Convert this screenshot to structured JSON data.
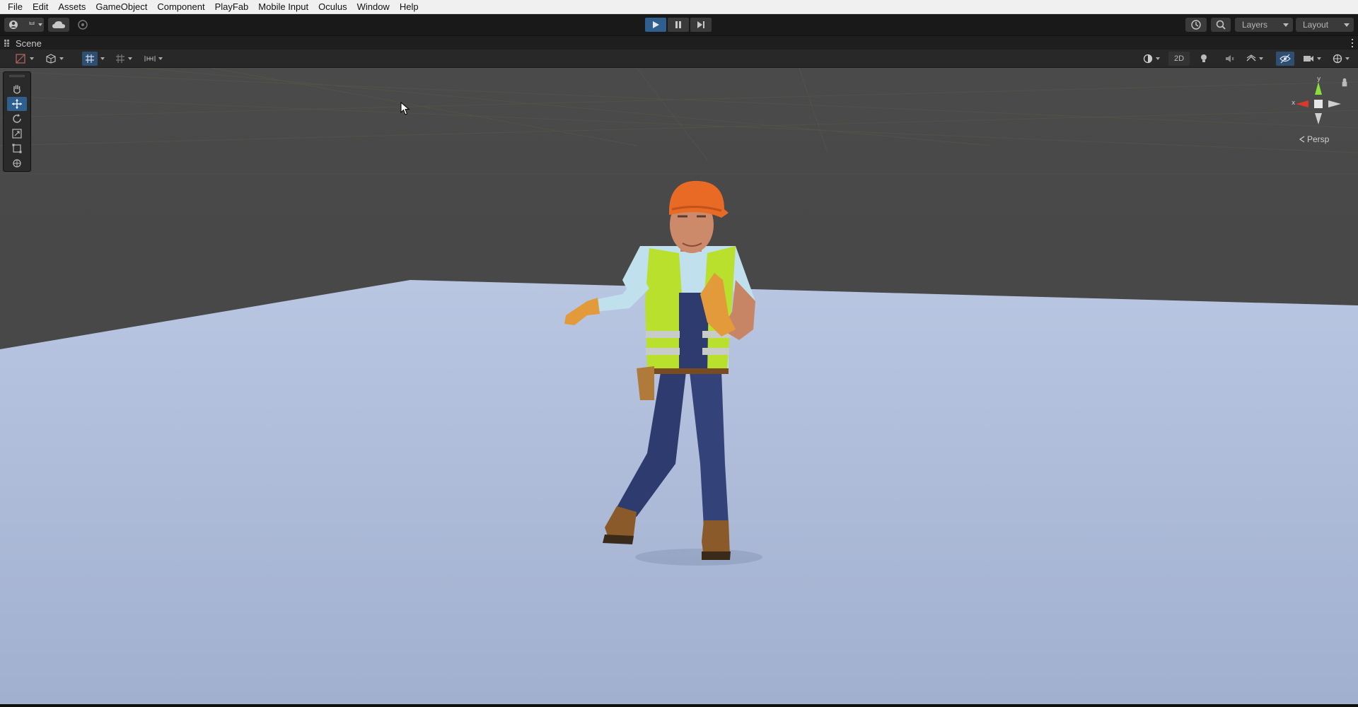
{
  "menu": {
    "items": [
      "File",
      "Edit",
      "Assets",
      "GameObject",
      "Component",
      "PlayFab",
      "Mobile Input",
      "Oculus",
      "Window",
      "Help"
    ]
  },
  "toolbar": {
    "account_icon": "account-icon",
    "cloud_icon": "cloud-icon",
    "collab_icon": "collab-icon",
    "play_icon": "play-icon",
    "pause_icon": "pause-icon",
    "step_icon": "step-icon",
    "history_icon": "history-icon",
    "search_icon": "search-icon",
    "layers_label": "Layers",
    "layout_label": "Layout",
    "play_state": "playing",
    "accent_color": "#2f5f8f"
  },
  "scene_tab": {
    "label": "Scene",
    "icon": "scene-grid-icon"
  },
  "scene_toolbar": {
    "mode_2d_label": "2D",
    "icons": [
      "draw-mode-icon",
      "gizmo-3d-icon",
      "grid-snap-icon",
      "grid-icon",
      "increment-snap-icon",
      "shading-icon",
      "lighting-icon",
      "audio-icon",
      "effects-icon",
      "hidden-objects-icon",
      "camera-icon",
      "gizmos-icon"
    ]
  },
  "tools": [
    "hand-tool-icon",
    "move-tool-icon",
    "rotate-tool-icon",
    "scale-tool-icon",
    "rect-tool-icon",
    "transform-tool-icon"
  ],
  "gizmo": {
    "y_label": "y",
    "x_label": "x",
    "view_label": "Persp"
  },
  "scene": {
    "sky_color": "#474747",
    "ground_color": "#a9b8d8",
    "character": "construction-worker-model"
  }
}
